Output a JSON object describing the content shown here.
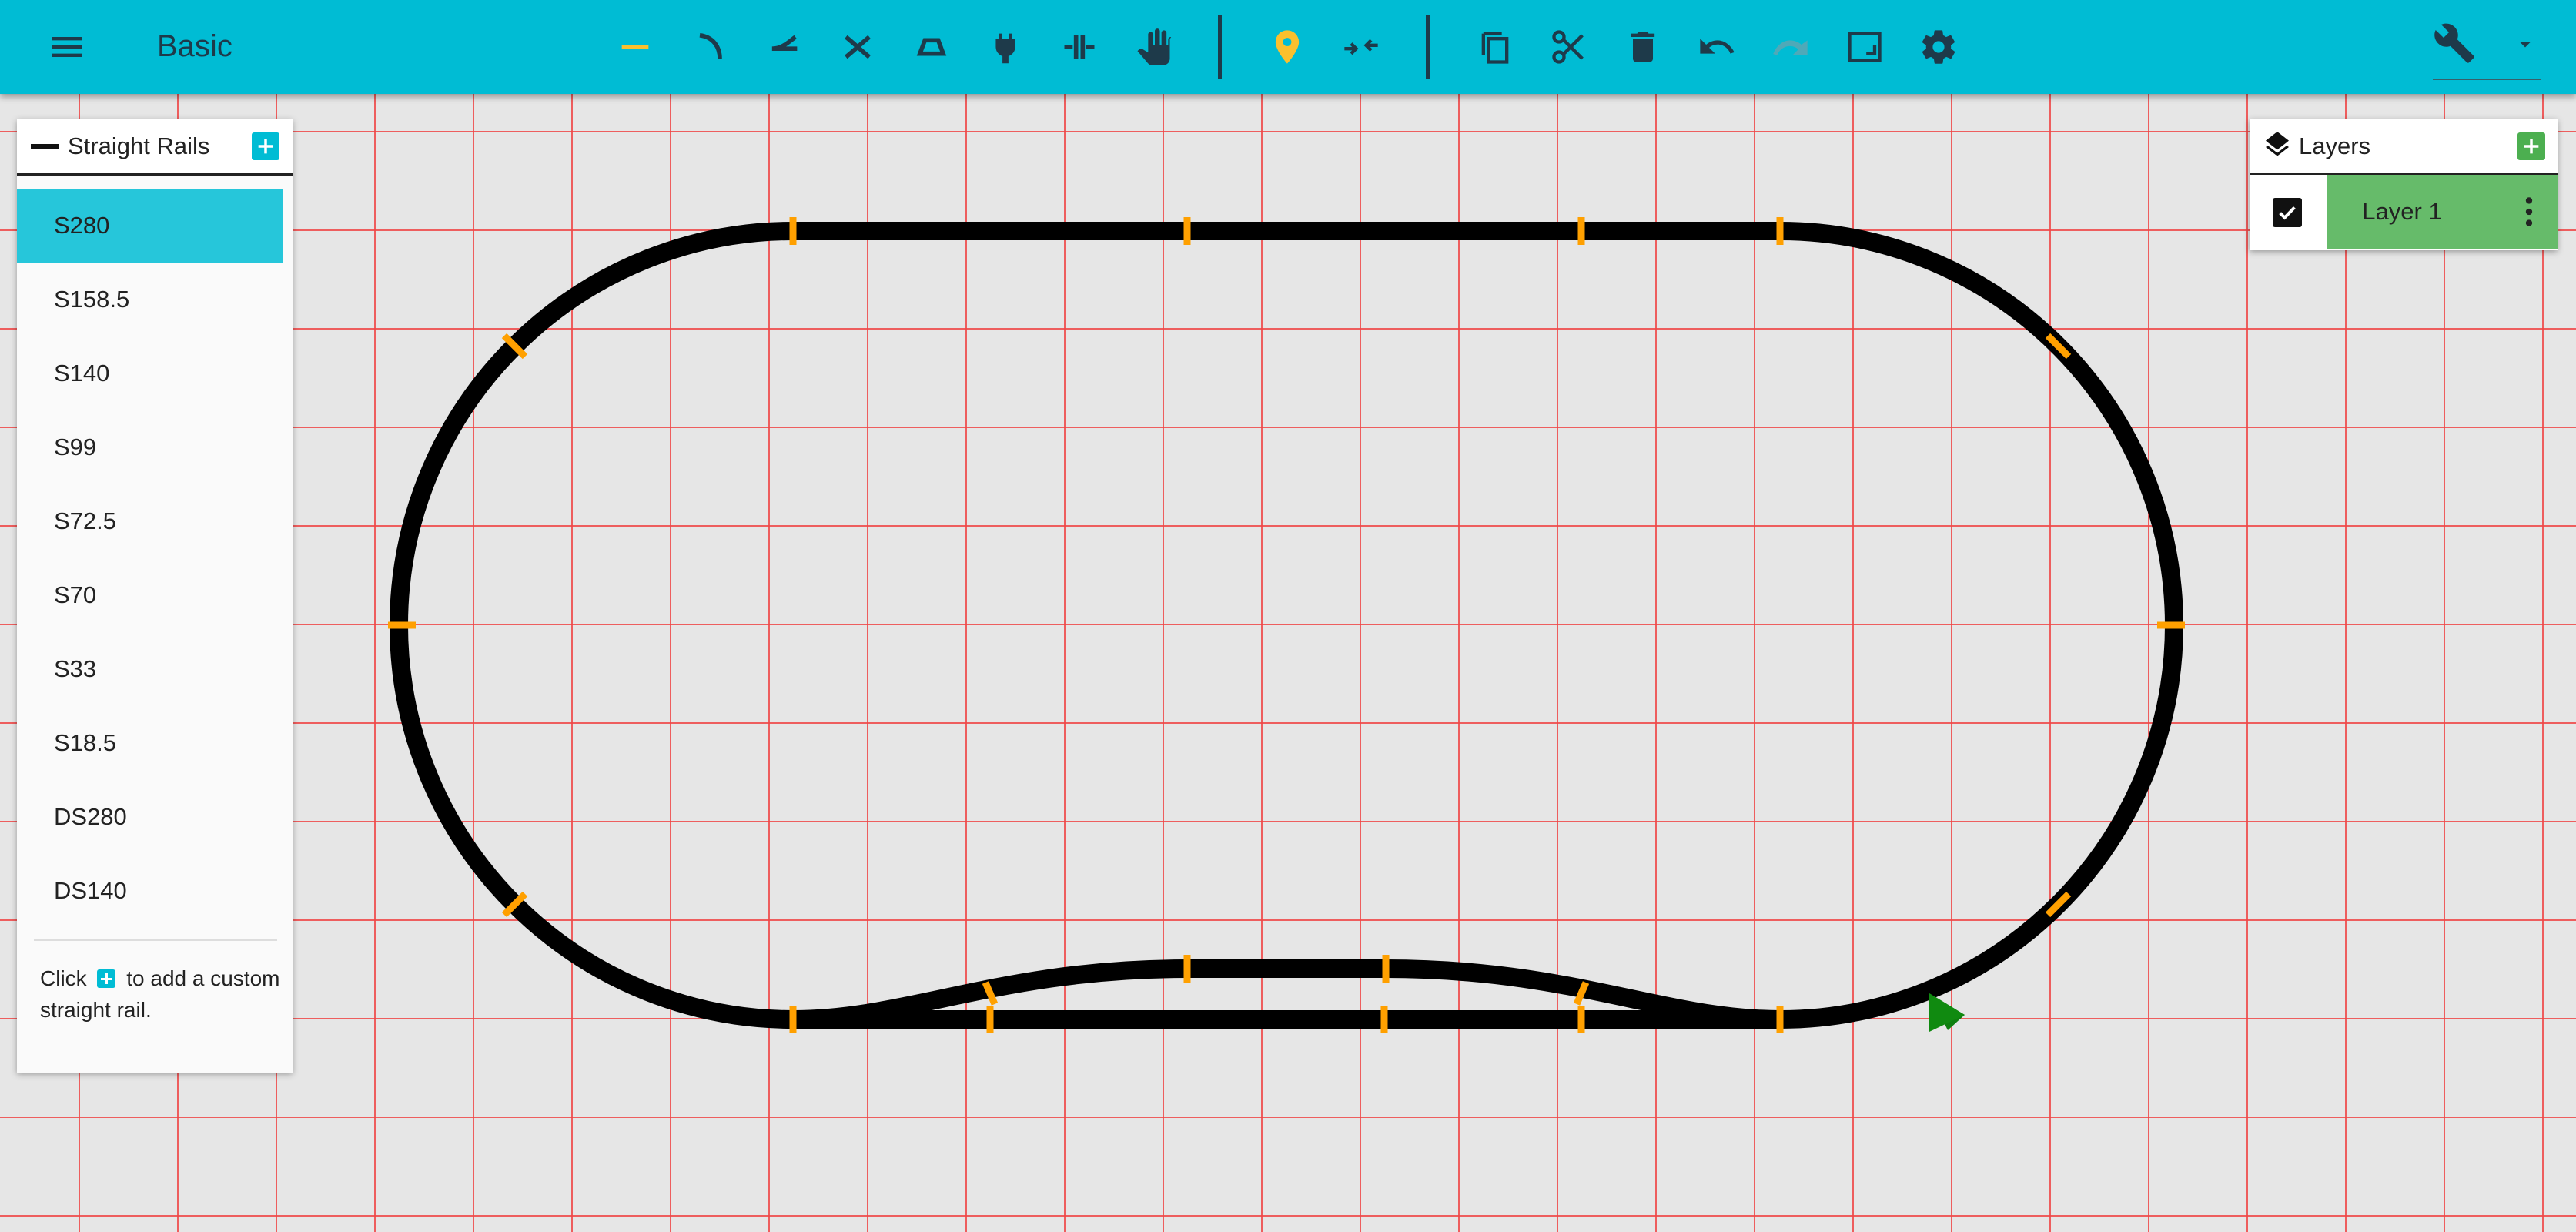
{
  "app": {
    "title": "Basic"
  },
  "toolbar": {
    "left_icons": [
      "menu-icon"
    ],
    "tools": [
      "straight-rail-icon",
      "curve-rail-icon",
      "turnout-icon",
      "crossing-icon",
      "bumper-icon",
      "feeder-icon",
      "insulator-icon",
      "hand-icon",
      "pin-icon",
      "align-icon",
      "copy-icon",
      "cut-icon",
      "delete-icon",
      "undo-icon",
      "redo-icon",
      "frame-icon",
      "settings-icon"
    ],
    "right_icons": [
      "wrench-icon",
      "dropdown-arrow-icon"
    ],
    "colors": {
      "bar": "#00bcd4",
      "icon": "#1e3a4a",
      "active": "#fbc02d",
      "disabled": "#4fa9b8"
    }
  },
  "rail_panel": {
    "title": "Straight Rails",
    "items": [
      "S280",
      "S158.5",
      "S140",
      "S99",
      "S72.5",
      "S70",
      "S33",
      "S18.5",
      "DS280",
      "DS140"
    ],
    "selected": "S280",
    "hint_before": "Click",
    "hint_after": "to add a custom straight rail."
  },
  "layers_panel": {
    "title": "Layers",
    "layers": [
      {
        "name": "Layer 1",
        "visible": true
      }
    ]
  },
  "colors": {
    "accent": "#00bcd4",
    "selected_item": "#26c6da",
    "layer_green": "#66bb6a",
    "grid": "#f04646",
    "rail": "#000000",
    "joint": "#ffa000",
    "marker": "#108a10"
  }
}
